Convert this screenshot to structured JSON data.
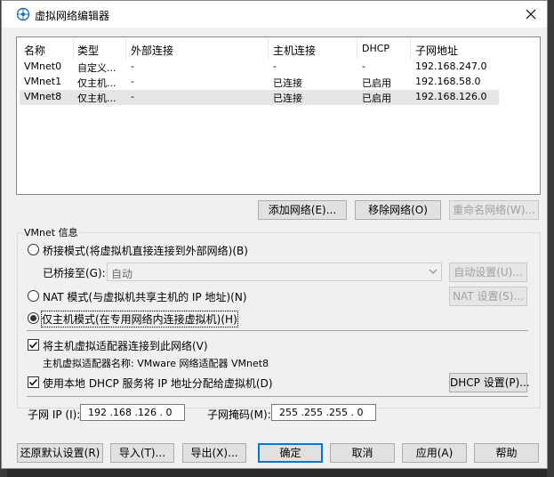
{
  "window": {
    "title": "虚拟网络编辑器",
    "icon": "vmware-network-icon"
  },
  "table": {
    "headers": [
      "名称",
      "类型",
      "外部连接",
      "主机连接",
      "DHCP",
      "子网地址"
    ],
    "rows": [
      {
        "name": "VMnet0",
        "type": "自定义...",
        "external": "-",
        "host": "-",
        "dhcp": "-",
        "subnet": "192.168.247.0"
      },
      {
        "name": "VMnet1",
        "type": "仅主机...",
        "external": "-",
        "host": "已连接",
        "dhcp": "已启用",
        "subnet": "192.168.58.0"
      },
      {
        "name": "VMnet8",
        "type": "仅主机...",
        "external": "-",
        "host": "已连接",
        "dhcp": "已启用",
        "subnet": "192.168.126.0"
      }
    ]
  },
  "table_buttons": {
    "add": "添加网络(E)...",
    "remove": "移除网络(O)",
    "rename": "重命名网络(W)..."
  },
  "info": {
    "group_title": "VMnet 信息",
    "bridge_label": "桥接模式(将虚拟机直接连接到外部网络)(B)",
    "bridged_to_label": "已桥接至(G):",
    "bridged_to_value": "自动",
    "auto_settings": "自动设置(U)...",
    "nat_label": "NAT 模式(与虚拟机共享主机的 IP 地址)(N)",
    "nat_settings": "NAT 设置(S)...",
    "hostonly_label": "仅主机模式(在专用网络内连接虚拟机)(H)",
    "selected_mode": "hostonly",
    "connect_adapter_label": "将主机虚拟适配器连接到此网络(V)",
    "connect_adapter_checked": true,
    "adapter_name": "主机虚拟适配器名称: VMware 网络适配器 VMnet8",
    "dhcp_label": "使用本地 DHCP 服务将 IP 地址分配给虚拟机(D)",
    "dhcp_checked": true,
    "dhcp_settings": "DHCP 设置(P)...",
    "subnet_ip_label": "子网 IP (I):",
    "subnet_ip": "192 .168 .126 . 0",
    "subnet_mask_label": "子网掩码(M):",
    "subnet_mask": "255 .255 .255 . 0"
  },
  "footer": {
    "restore": "还原默认设置(R)",
    "import": "导入(T)...",
    "export": "导出(X)...",
    "ok": "确定",
    "cancel": "取消",
    "apply": "应用(A)",
    "help": "帮助"
  },
  "colors": {
    "selection": "#e5e5e5",
    "focus_border": "#0078d7",
    "window_bg": "#f0f0f0"
  }
}
